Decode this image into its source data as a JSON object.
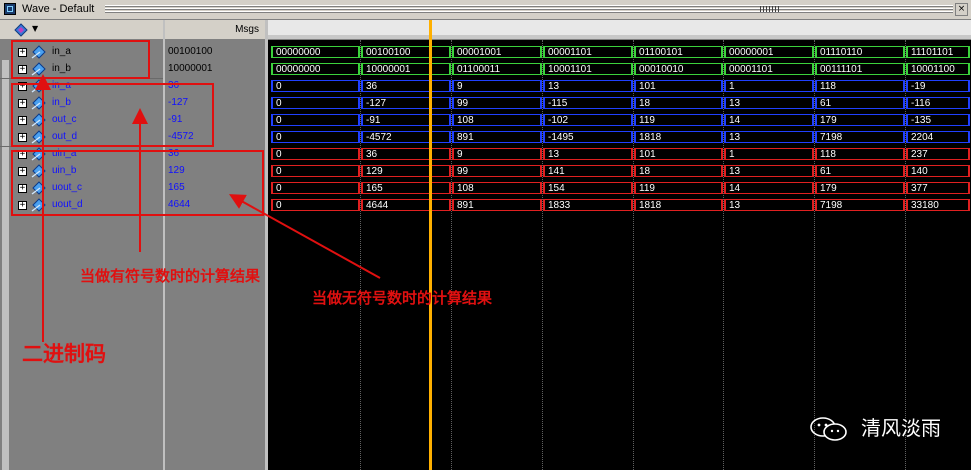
{
  "window": {
    "title": "Wave - Default",
    "close_glyph": "×",
    "values_header": "Msgs"
  },
  "icons": {
    "toolbar": "wave-dropdown-icon",
    "signal": "signal-diamond-icon",
    "expand": "plus-box-icon"
  },
  "colors": {
    "binary_bus": "#3cd23c",
    "signed_bus": "#2040ff",
    "unsigned_bus": "#e02020",
    "cursor": "#ffb000",
    "annotation": "#e01010"
  },
  "signals": [
    {
      "name": "in_a",
      "value": "00100100",
      "group": "binary",
      "waves": [
        "00000000",
        "00100100",
        "00001001",
        "00001101",
        "01100101",
        "00000001",
        "01110110",
        "11101101"
      ]
    },
    {
      "name": "in_b",
      "value": "10000001",
      "group": "binary",
      "waves": [
        "00000000",
        "10000001",
        "01100011",
        "10001101",
        "00010010",
        "00001101",
        "00111101",
        "10001100"
      ]
    },
    {
      "name": "in_a",
      "value": "36",
      "group": "signed",
      "waves": [
        "0",
        "36",
        "9",
        "13",
        "101",
        "1",
        "118",
        "-19"
      ]
    },
    {
      "name": "in_b",
      "value": "-127",
      "group": "signed",
      "waves": [
        "0",
        "-127",
        "99",
        "-115",
        "18",
        "13",
        "61",
        "-116"
      ]
    },
    {
      "name": "out_c",
      "value": "-91",
      "group": "signed",
      "waves": [
        "0",
        "-91",
        "108",
        "-102",
        "119",
        "14",
        "179",
        "-135"
      ]
    },
    {
      "name": "out_d",
      "value": "-4572",
      "group": "signed",
      "waves": [
        "0",
        "-4572",
        "891",
        "-1495",
        "1818",
        "13",
        "7198",
        "2204"
      ]
    },
    {
      "name": "uin_a",
      "value": "36",
      "group": "unsigned",
      "waves": [
        "0",
        "36",
        "9",
        "13",
        "101",
        "1",
        "118",
        "237"
      ]
    },
    {
      "name": "uin_b",
      "value": "129",
      "group": "unsigned",
      "waves": [
        "0",
        "129",
        "99",
        "141",
        "18",
        "13",
        "61",
        "140"
      ]
    },
    {
      "name": "uout_c",
      "value": "165",
      "group": "unsigned",
      "waves": [
        "0",
        "165",
        "108",
        "154",
        "119",
        "14",
        "179",
        "377"
      ]
    },
    {
      "name": "uout_d",
      "value": "4644",
      "group": "unsigned",
      "waves": [
        "0",
        "4644",
        "891",
        "1833",
        "1818",
        "13",
        "7198",
        "33180"
      ]
    }
  ],
  "annotations": {
    "signed_label": "当做有符号数时的计算结果",
    "unsigned_label": "当做无符号数时的计算结果",
    "binary_label": "二进制码"
  },
  "watermark": {
    "text": "清风淡雨"
  }
}
